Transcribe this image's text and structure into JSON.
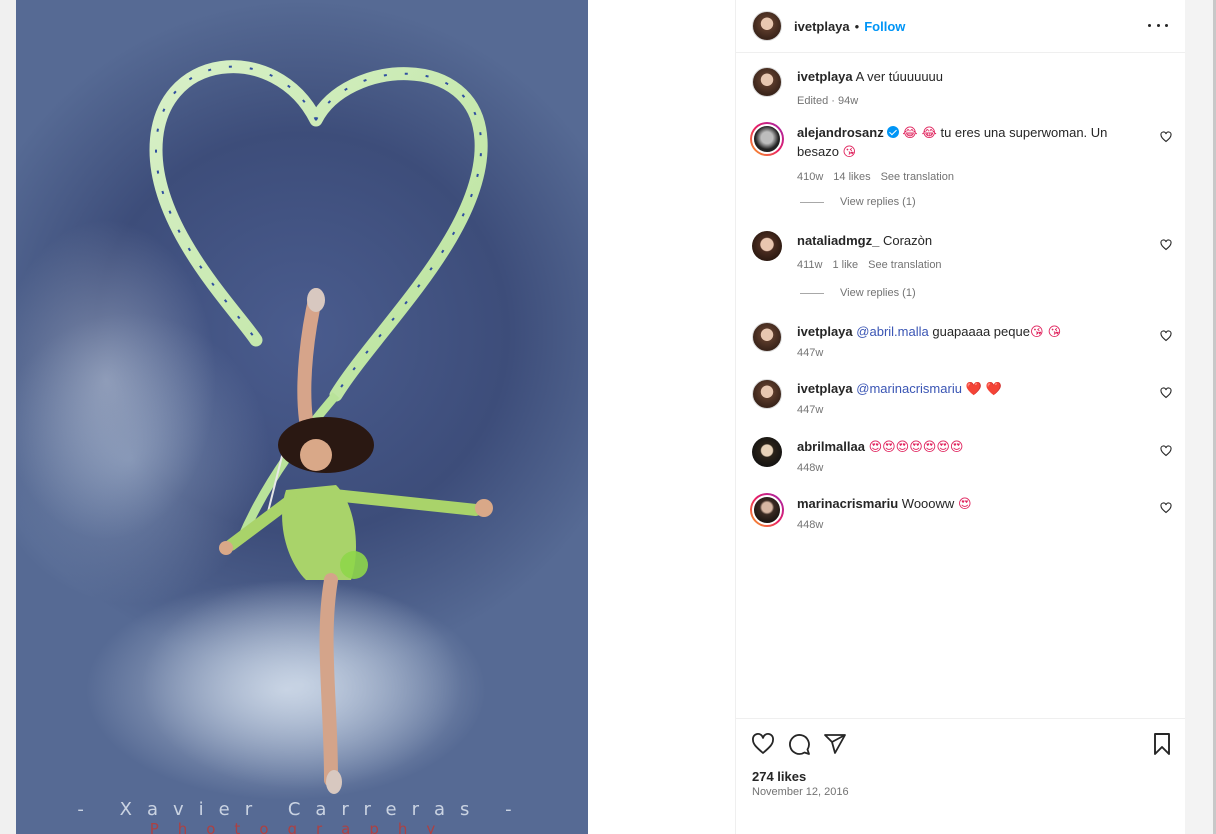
{
  "post": {
    "author": "ivetplaya",
    "follow_label": "Follow",
    "dot": "•",
    "caption": {
      "username": "ivetplaya",
      "text": "A ver túuuuuuu",
      "meta": "Edited · 94w"
    },
    "photo_watermark_line1": "- Xavier Carreras -",
    "photo_watermark_line2": "Photography"
  },
  "comments": [
    {
      "username": "alejandrosanz",
      "verified": true,
      "emoji_pre": "😂 😂",
      "text": "tu eres una superwoman. Un besazo",
      "emoji_post": "😘",
      "time": "410w",
      "likes": "14 likes",
      "translation": "See translation",
      "replies": "View replies (1)"
    },
    {
      "username": "nataliadmgz_",
      "text": "Corazòn",
      "time": "411w",
      "likes": "1 like",
      "translation": "See translation",
      "replies": "View replies (1)"
    },
    {
      "username": "ivetplaya",
      "mention": "@abril.malla",
      "text": "guapaaaa peque",
      "emoji_post": "😘 😘",
      "time": "447w"
    },
    {
      "username": "ivetplaya",
      "mention": "@marinacrismariu",
      "emoji_post": "❤️ ❤️",
      "time": "447w"
    },
    {
      "username": "abrilmallaa",
      "emoji_post": "😍😍😍😍😍😍😍",
      "time": "448w"
    },
    {
      "username": "marinacrismariu",
      "text": "Woooww",
      "emoji_post": "😍",
      "time": "448w"
    }
  ],
  "footer": {
    "likes": "274 likes",
    "date": "November 12, 2016"
  },
  "icons": {
    "like": "heart-icon",
    "comment": "comment-icon",
    "share": "paper-plane-icon",
    "save": "bookmark-icon",
    "more": "more-options-icon"
  },
  "colors": {
    "follow": "#0095f6",
    "mention": "#3a55b4",
    "muted": "#737373"
  }
}
